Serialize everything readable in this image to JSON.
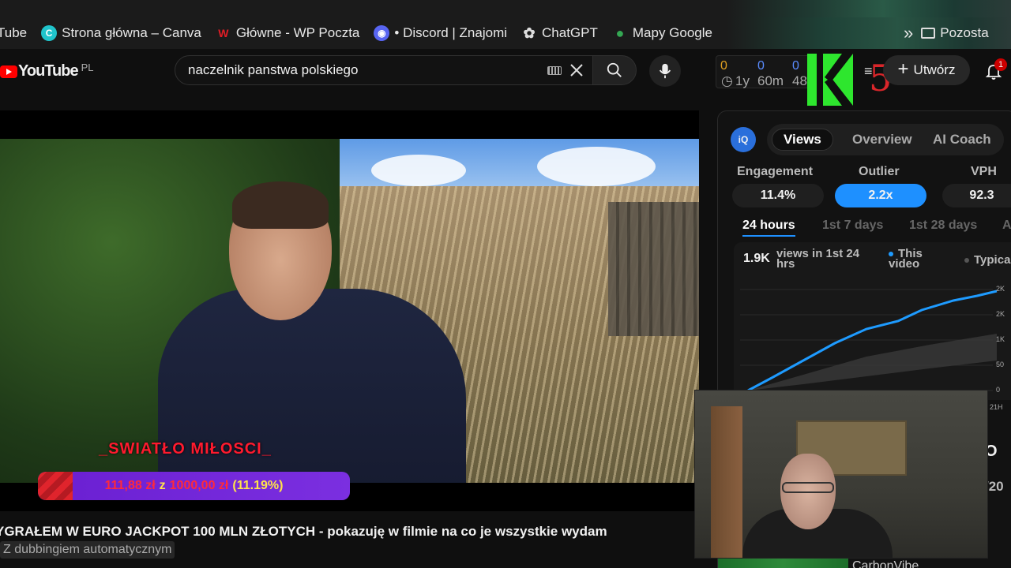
{
  "browser": {
    "bookmarks": [
      {
        "label": "Tube",
        "icon": "youtube-icon"
      },
      {
        "label": "Strona główna – Canva",
        "icon": "canva-icon",
        "color": "#20c4cb"
      },
      {
        "label": "Główne - WP Poczta",
        "icon": "wp-icon",
        "color": "#e21c25"
      },
      {
        "label": "• Discord | Znajomi",
        "icon": "discord-icon",
        "color": "#5865f2"
      },
      {
        "label": "ChatGPT",
        "icon": "chatgpt-icon",
        "color": "#dddddd"
      },
      {
        "label": "Mapy Google",
        "icon": "maps-pin-icon",
        "color": "#34a853"
      }
    ],
    "more_bookmarks": "»",
    "folder_label": "Pozosta"
  },
  "youtube": {
    "logo_text": "YouTube",
    "region": "PL",
    "search_value": "naczelnik panstwa polskiego",
    "create_label": "Utwórz",
    "notification_count": "1",
    "extension_stats": {
      "values": [
        "0",
        "0",
        "0"
      ],
      "times": [
        "1y",
        "60m",
        "48"
      ]
    },
    "k5_label": "5"
  },
  "player": {
    "overlay_text": "_SWIATŁO MIŁOSCI_",
    "goal": {
      "current": "111,88 zł",
      "sep": "z",
      "target": "1000,00 zł",
      "percent_text": "(11.19%)",
      "fraction": 0.1119
    }
  },
  "video": {
    "title": "YGRAŁEM W EURO JACKPOT 100 MLN ZŁOTYCH - pokazuję w filmie na co je wszystkie wydam",
    "dubbing": "Z dubbingiem automatycznym"
  },
  "vidiq": {
    "badge": "iQ",
    "tabs": [
      "Views",
      "Overview",
      "AI Coach"
    ],
    "metrics": [
      {
        "label": "Engagement",
        "value": "11.4%"
      },
      {
        "label": "Outlier",
        "value": "2.2x"
      },
      {
        "label": "VPH",
        "value": "92.3"
      }
    ],
    "periods": [
      "24 hours",
      "1st 7 days",
      "1st 28 days",
      "A"
    ],
    "chart_head": "1.9K",
    "chart_sub": "views in 1st 24 hrs",
    "legend_this": "This video",
    "legend_typical": "Typica",
    "y_ticks": [
      "2K",
      "2K",
      "1K",
      "50",
      "0"
    ],
    "x_tick": "21H",
    "extra_a": "O",
    "extra_b": "/20",
    "footer_text": "CarbonVibe"
  }
}
